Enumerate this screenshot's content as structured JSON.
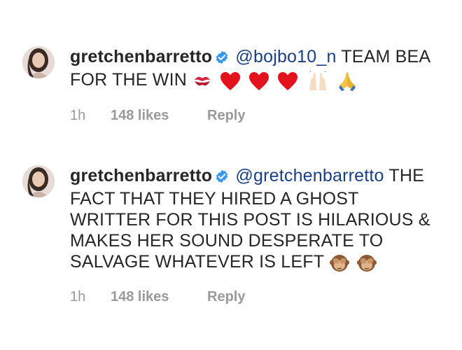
{
  "comments": [
    {
      "username": "gretchenbarretto",
      "mention": "@bojbo10_n",
      "text": "TEAM BEA FOR THE WIN",
      "emojis": [
        "kiss-mark-icon",
        "red-heart-icon",
        "red-heart-icon",
        "red-heart-icon",
        "raising-hands-icon",
        "folded-hands-icon"
      ],
      "time": "1h",
      "likes": "148 likes",
      "reply": "Reply"
    },
    {
      "username": "gretchenbarretto",
      "mention": "@gretchenbarretto",
      "text": "THE FACT THAT THEY HIRED A GHOST WRITTER FOR THIS POST IS HILARIOUS & MAKES HER SOUND DESPERATE TO SALVAGE WHATEVER IS LEFT",
      "emojis": [
        "see-no-evil-monkey-icon",
        "see-no-evil-monkey-icon"
      ],
      "time": "1h",
      "likes": "148 likes",
      "reply": "Reply"
    }
  ],
  "colors": {
    "text": "#262626",
    "mention": "#1b3f85",
    "meta": "#9a9a9a",
    "verified": "#3897f0"
  }
}
